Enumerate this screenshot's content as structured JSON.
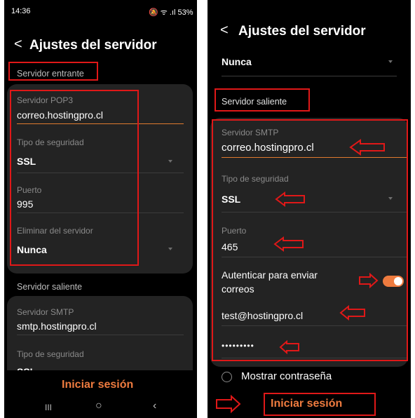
{
  "left": {
    "status": {
      "time": "14:36",
      "icons": "🔕 ᯤ .ıl 53%"
    },
    "title": "Ajustes del servidor",
    "incoming": {
      "section": "Servidor entrante",
      "server_label": "Servidor POP3",
      "server_value": "correo.hostingpro.cl",
      "security_label": "Tipo de seguridad",
      "security_value": "SSL",
      "port_label": "Puerto",
      "port_value": "995",
      "delete_label": "Eliminar del servidor",
      "delete_value": "Nunca"
    },
    "outgoing": {
      "section": "Servidor saliente",
      "server_label": "Servidor SMTP",
      "server_value": "smtp.hostingpro.cl",
      "security_label": "Tipo de seguridad",
      "security_value_partial": "SSL"
    },
    "signin": "Iniciar sesión",
    "nav": {
      "recent": "III",
      "home": "○",
      "back": "‹"
    }
  },
  "right": {
    "title": "Ajustes del servidor",
    "delete_value": "Nunca",
    "outgoing": {
      "section": "Servidor saliente",
      "server_label": "Servidor SMTP",
      "server_value": "correo.hostingpro.cl",
      "security_label": "Tipo de seguridad",
      "security_value": "SSL",
      "port_label": "Puerto",
      "port_value": "465",
      "auth_label": "Autenticar para enviar correos",
      "auth_enabled": true,
      "username": "test@hostingpro.cl",
      "password": "•••••••••"
    },
    "show_password": "Mostrar contraseña",
    "signin": "Iniciar sesión"
  },
  "colors": {
    "accent": "#ee7b3f",
    "annotation": "#e01818",
    "card": "#232323"
  }
}
